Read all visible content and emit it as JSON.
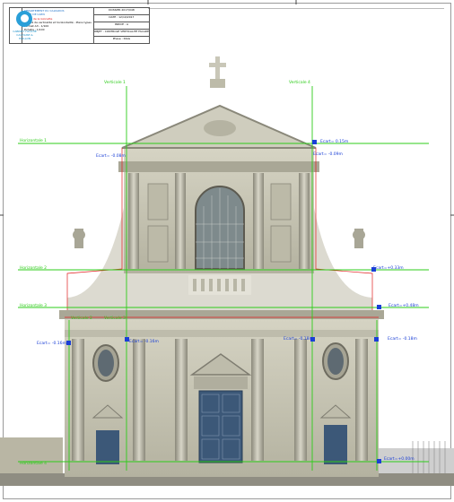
{
  "cartouche": {
    "logo_text": "CABINET FOUCHE CACHAISE & HUILLON",
    "dept": "DEPARTEMENT DU CALVADOS",
    "city": "VILLE DE CAEN",
    "building": "Eglise de la Gloriette",
    "drawing_title": "Relevé de verticalité et horizontalité - Plans types",
    "format": "Format A3 - 1/100",
    "scale": "Echelle : 1/100",
    "meta": [
      "DOSSIER 2017/048",
      "DATE : 12/10/2017",
      "INDICE : A",
      "OBJET : CONTROLE VERTICALITE FACADE",
      "Phase : DIAG"
    ]
  },
  "annotations": {
    "verticale_1": "Verticale 1",
    "verticale_2": "Verticale 2",
    "verticale_3": "Verticale 3",
    "verticale_4": "Verticale 4",
    "horizontale_1": "Horizontale 1",
    "horizontale_2": "Horizontale 2",
    "horizontale_3": "Horizontale 3",
    "horizontale_4": "Horizontale 4",
    "ecart_1": "Ecart= -0.08m",
    "ecart_2": "Ecart= 0.15m",
    "ecart_3": "Ecart= -0.09m",
    "ecart_4": "Ecart=+0.33m",
    "ecart_5": "Ecart=+0.48m",
    "ecart_6": "Ecart= -0.16m",
    "ecart_7": "Ecart= -0.16m",
    "ecart_8": "Ecart= -0.18m",
    "ecart_9": "Ecart= -0.18m",
    "ecart_10": "Ecart=+0.00m"
  },
  "colors": {
    "guide_green": "#2ecc1a",
    "stone": "#c8c6b4",
    "stone_dark": "#8e8c7c",
    "door": "#3c5878",
    "ecart_blue": "#1a3fd6"
  }
}
